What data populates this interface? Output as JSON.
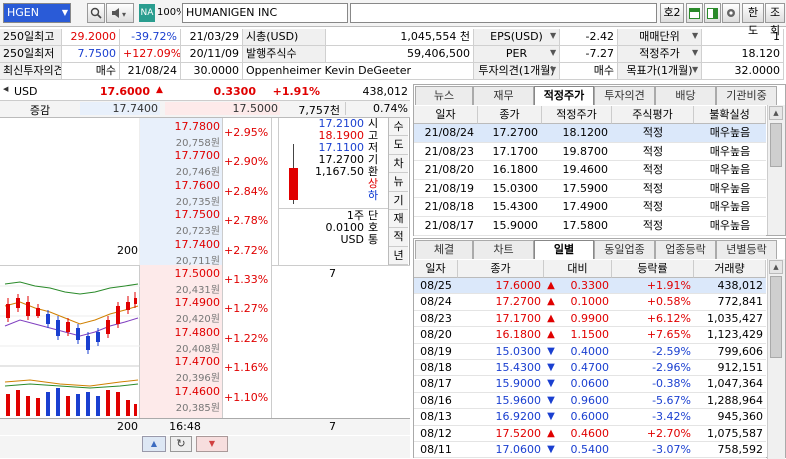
{
  "toolbar": {
    "code": "HGEN",
    "market_badge": "NA",
    "pct": "100%",
    "name": "HUMANIGEN INC",
    "btn_ho": "호2",
    "btn_limit": "한도",
    "btn_query": "조회"
  },
  "info": {
    "rows": [
      {
        "label": "250일최고",
        "price": "29.2000",
        "rate": "-39.72%",
        "date": "21/03/29",
        "label2": "시총(USD)",
        "val2": "1,045,554 천",
        "label3": "EPS(USD)",
        "val3": "-2.42",
        "label4": "매매단위",
        "val4": "1"
      },
      {
        "label": "250일최저",
        "price": "7.7500",
        "rate": "+127.09%",
        "date": "20/11/09",
        "label2": "발행주식수",
        "val2": "59,406,500",
        "label3": "PER",
        "val3": "-7.27",
        "label4": "적정주가",
        "val4": "18.120"
      },
      {
        "label": "최신투자의견",
        "price": "매수",
        "rate": "21/08/24",
        "date": "30.0000",
        "label2": "Oppenheimer Kevin DeGeeter",
        "val2": "",
        "label3": "투자의견(1개월)",
        "val3": "매수",
        "label4": "목표가(1개월)",
        "val4": "32.0000"
      }
    ]
  },
  "quote": {
    "currency": "USD",
    "price": "17.6000",
    "change": "0.3300",
    "rate": "+1.91%",
    "volume": "438,012",
    "label_inc": "증감",
    "bid": "17.7400",
    "ask": "17.5000",
    "amount": "7,757천",
    "ratio": "0.74%"
  },
  "orderbook": {
    "asks": [
      {
        "price": "17.7800",
        "won": "20,758원",
        "rate": "+2.95%"
      },
      {
        "price": "17.7700",
        "won": "20,746원",
        "rate": "+2.90%"
      },
      {
        "price": "17.7600",
        "won": "20,735원",
        "rate": "+2.84%"
      },
      {
        "price": "17.7500",
        "won": "20,723원",
        "rate": "+2.78%"
      },
      {
        "price": "17.7400",
        "won": "20,711원",
        "rate": "+2.72%",
        "qty": "200"
      }
    ],
    "bids": [
      {
        "price": "17.5000",
        "won": "20,431원",
        "rate": "+1.33%",
        "qty": "7"
      },
      {
        "price": "17.4900",
        "won": "20,420원",
        "rate": "+1.27%"
      },
      {
        "price": "17.4800",
        "won": "20,408원",
        "rate": "+1.22%"
      },
      {
        "price": "17.4700",
        "won": "20,396원",
        "rate": "+1.16%"
      },
      {
        "price": "17.4600",
        "won": "20,385원",
        "rate": "+1.10%"
      }
    ],
    "side_vals": [
      "17.2100",
      "18.1900",
      "17.1100",
      "17.2700",
      "1,167.50"
    ],
    "side_labels": [
      "시",
      "고",
      "저",
      "기",
      "환"
    ],
    "limit_up": "상",
    "limit_down": "하",
    "unit_vals": [
      "1주",
      "0.0100",
      "USD"
    ],
    "unit_labels": [
      "단",
      "호",
      "통"
    ],
    "vtabs": [
      "수",
      "도",
      "차",
      "뉴",
      "기",
      "재",
      "적",
      "년"
    ],
    "total_ask": "200",
    "time": "16:48",
    "total_bid": "7"
  },
  "opinion": {
    "tabs": [
      "뉴스",
      "재무",
      "적정주가",
      "투자의견",
      "배당",
      "기관비중"
    ],
    "headers": [
      "일자",
      "종가",
      "적정주가",
      "주식평가",
      "불확실성"
    ],
    "rows": [
      [
        "21/08/24",
        "17.2700",
        "18.1200",
        "적정",
        "매우높음"
      ],
      [
        "21/08/23",
        "17.1700",
        "19.8700",
        "적정",
        "매우높음"
      ],
      [
        "21/08/20",
        "16.1800",
        "19.4600",
        "적정",
        "매우높음"
      ],
      [
        "21/08/19",
        "15.0300",
        "17.5900",
        "적정",
        "매우높음"
      ],
      [
        "21/08/18",
        "15.4300",
        "17.4900",
        "적정",
        "매우높음"
      ],
      [
        "21/08/17",
        "15.9000",
        "17.5800",
        "적정",
        "매우높음"
      ]
    ]
  },
  "daily": {
    "tabs": [
      "체결",
      "차트",
      "일별",
      "동일업종",
      "업종등락",
      "년별등락"
    ],
    "headers": [
      "일자",
      "종가",
      "대비",
      "등락률",
      "거래량"
    ],
    "rows": [
      [
        "08/25",
        "17.6000",
        "up",
        "0.3300",
        "+1.91%",
        "438,012"
      ],
      [
        "08/24",
        "17.2700",
        "up",
        "0.1000",
        "+0.58%",
        "772,841"
      ],
      [
        "08/23",
        "17.1700",
        "up",
        "0.9900",
        "+6.12%",
        "1,035,427"
      ],
      [
        "08/20",
        "16.1800",
        "up",
        "1.1500",
        "+7.65%",
        "1,123,429"
      ],
      [
        "08/19",
        "15.0300",
        "dn",
        "0.4000",
        "-2.59%",
        "799,606"
      ],
      [
        "08/18",
        "15.4300",
        "dn",
        "0.4700",
        "-2.96%",
        "912,151"
      ],
      [
        "08/17",
        "15.9000",
        "dn",
        "0.0600",
        "-0.38%",
        "1,047,364"
      ],
      [
        "08/16",
        "15.9600",
        "dn",
        "0.9600",
        "-5.67%",
        "1,288,964"
      ],
      [
        "08/13",
        "16.9200",
        "dn",
        "0.6000",
        "-3.42%",
        "945,360"
      ],
      [
        "08/12",
        "17.5200",
        "up",
        "0.4600",
        "+2.70%",
        "1,075,587"
      ],
      [
        "08/11",
        "17.0600",
        "dn",
        "0.5400",
        "-3.07%",
        "758,592"
      ]
    ]
  },
  "colors": {
    "up": "#e00000",
    "down": "#1a3fd0",
    "ask_bg": "#e8f0fb",
    "bid_bg": "#fdeaea"
  }
}
